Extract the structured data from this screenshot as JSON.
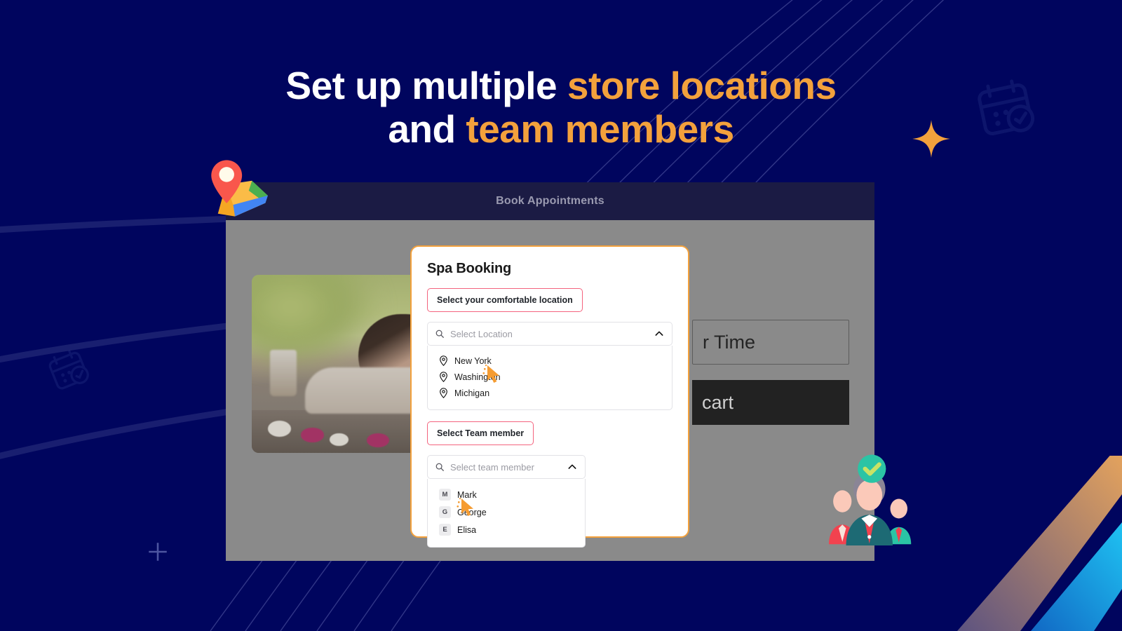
{
  "theme": {
    "bg_navy": "#00055E",
    "accent_orange": "#F3A13C",
    "badge_pink": "#F4637E",
    "titlebar": "#1B1B44",
    "overlay_gray": "#8A8A8A"
  },
  "headline": {
    "line1_plain": "Set up multiple ",
    "line1_highlight": "store locations",
    "line2_plain": "and ",
    "line2_highlight": "team members"
  },
  "app_window": {
    "titlebar_label": "Book Appointments",
    "background_widgets": {
      "time_field_text": "r Time",
      "cart_button_text": "cart"
    },
    "photo_alt": "spa-massage-photo"
  },
  "modal": {
    "title": "Spa Booking",
    "location_section": {
      "badge_label": "Select your comfortable location",
      "select_placeholder": "Select Location",
      "chevron": "chevron-up",
      "options": [
        {
          "label": "New York",
          "icon": "map-pin-icon"
        },
        {
          "label": "Washington",
          "icon": "map-pin-icon"
        },
        {
          "label": "Michigan",
          "icon": "map-pin-icon"
        }
      ]
    },
    "team_section": {
      "badge_label": "Select Team member",
      "select_placeholder": "Select team member",
      "chevron": "chevron-up",
      "options": [
        {
          "label": "Mark",
          "initial": "M"
        },
        {
          "label": "George",
          "initial": "G"
        },
        {
          "label": "Elisa",
          "initial": "E"
        }
      ]
    }
  },
  "decorations": {
    "map_pin": "google-maps-pin-icon",
    "team_illustration": "team-members-illustration",
    "sparkle": "sparkle-icon",
    "calendar_top_right": "calendar-check-icon",
    "calendar_left": "calendar-check-icon",
    "plus_mark": "plus-crosshair-icon",
    "stripe_colors": [
      "#E8A55C",
      "#6E5A82",
      "#1B8FD8",
      "#1CB6EF"
    ]
  }
}
